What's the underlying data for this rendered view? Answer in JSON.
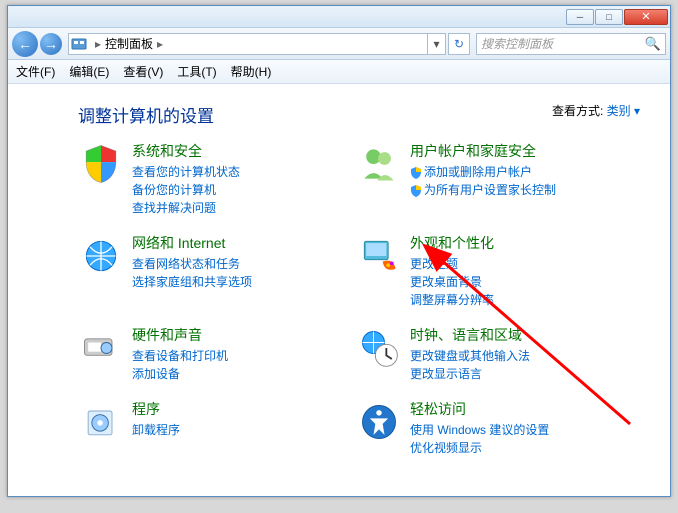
{
  "window": {
    "breadcrumb_location": "控制面板",
    "search_placeholder": "搜索控制面板"
  },
  "menubar": {
    "file": "文件(F)",
    "edit": "编辑(E)",
    "view": "查看(V)",
    "tools": "工具(T)",
    "help": "帮助(H)"
  },
  "content": {
    "heading": "调整计算机的设置",
    "viewby_label": "查看方式:",
    "viewby_value": "类别 ▾"
  },
  "categories": {
    "system_security": {
      "title": "系统和安全",
      "links": [
        "查看您的计算机状态",
        "备份您的计算机",
        "查找并解决问题"
      ]
    },
    "user_accounts": {
      "title": "用户帐户和家庭安全",
      "links": [
        "添加或删除用户帐户",
        "为所有用户设置家长控制"
      ],
      "shield": [
        true,
        true
      ]
    },
    "network": {
      "title": "网络和 Internet",
      "links": [
        "查看网络状态和任务",
        "选择家庭组和共享选项"
      ]
    },
    "appearance": {
      "title": "外观和个性化",
      "links": [
        "更改主题",
        "更改桌面背景",
        "调整屏幕分辨率"
      ]
    },
    "hardware": {
      "title": "硬件和声音",
      "links": [
        "查看设备和打印机",
        "添加设备"
      ]
    },
    "clock": {
      "title": "时钟、语言和区域",
      "links": [
        "更改键盘或其他输入法",
        "更改显示语言"
      ]
    },
    "programs": {
      "title": "程序",
      "links": [
        "卸载程序"
      ]
    },
    "ease": {
      "title": "轻松访问",
      "links": [
        "使用 Windows 建议的设置",
        "优化视频显示"
      ]
    }
  }
}
